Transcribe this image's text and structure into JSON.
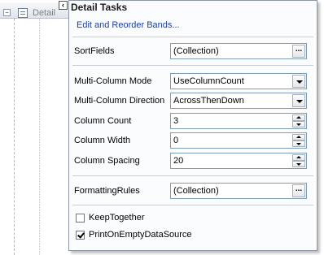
{
  "designer": {
    "band_label": "Detail"
  },
  "panel": {
    "title": "Detail Tasks",
    "edit_link": "Edit and Reorder Bands...",
    "sort_fields": {
      "label": "SortFields",
      "value": "(Collection)",
      "button": "..."
    },
    "multi_column_mode": {
      "label": "Multi-Column Mode",
      "value": "UseColumnCount"
    },
    "multi_column_direction": {
      "label": "Multi-Column Direction",
      "value": "AcrossThenDown"
    },
    "column_count": {
      "label": "Column Count",
      "value": "3"
    },
    "column_width": {
      "label": "Column Width",
      "value": "0"
    },
    "column_spacing": {
      "label": "Column Spacing",
      "value": "20"
    },
    "formatting_rules": {
      "label": "FormattingRules",
      "value": "(Collection)",
      "button": "..."
    },
    "keep_together": {
      "label": "KeepTogether",
      "checked": false
    },
    "print_on_empty": {
      "label": "PrintOnEmptyDataSource",
      "checked": true
    }
  },
  "icons": {
    "collapse": "minus-box-icon",
    "band": "band-icon",
    "smart_tag": "smart-tag-arrow-icon"
  },
  "colors": {
    "link": "#1f3f9c",
    "panel_background": "#fbfcfe",
    "field_border": "#7f9db9"
  }
}
